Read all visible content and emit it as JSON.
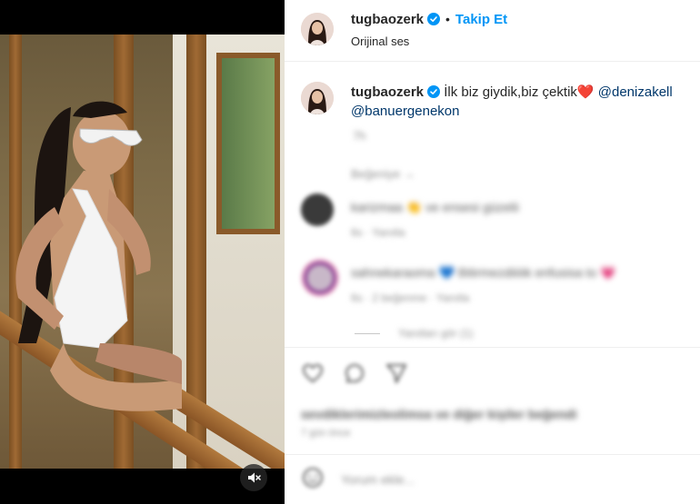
{
  "media": {
    "mute_icon": "speaker-muted-icon"
  },
  "header": {
    "username": "tugbaozerk",
    "separator": "•",
    "follow_label": "Takip Et",
    "audio_label": "Orijinal ses"
  },
  "caption": {
    "username": "tugbaozerk",
    "text": "İlk biz giydik,biz çektik",
    "emoji": "❤️",
    "mention_1": "@denizakell",
    "mention_2": "@banuergenekon",
    "time": "7h",
    "reply_label": "Beğeniye →"
  },
  "comments": [
    {
      "text": "karizmaa 👏 ve ensesi güzelii",
      "meta": "6s · Yanıtla"
    },
    {
      "text": "sahnekaraoma 💙 Bitirmezdiiiiik enfusisa to 💗",
      "meta": "6s · 2 beğenme · Yanıtla"
    }
  ],
  "view_replies": "Yanıtları gör (1)",
  "actions": {
    "like_icon": "heart-icon",
    "comment_icon": "comment-icon",
    "share_icon": "share-icon"
  },
  "likes_line": "sevdiklerimizleolimsa ve diğer kişiler beğendi",
  "post_date": "7 gün önce",
  "add_comment_placeholder": "Yorum ekle..."
}
